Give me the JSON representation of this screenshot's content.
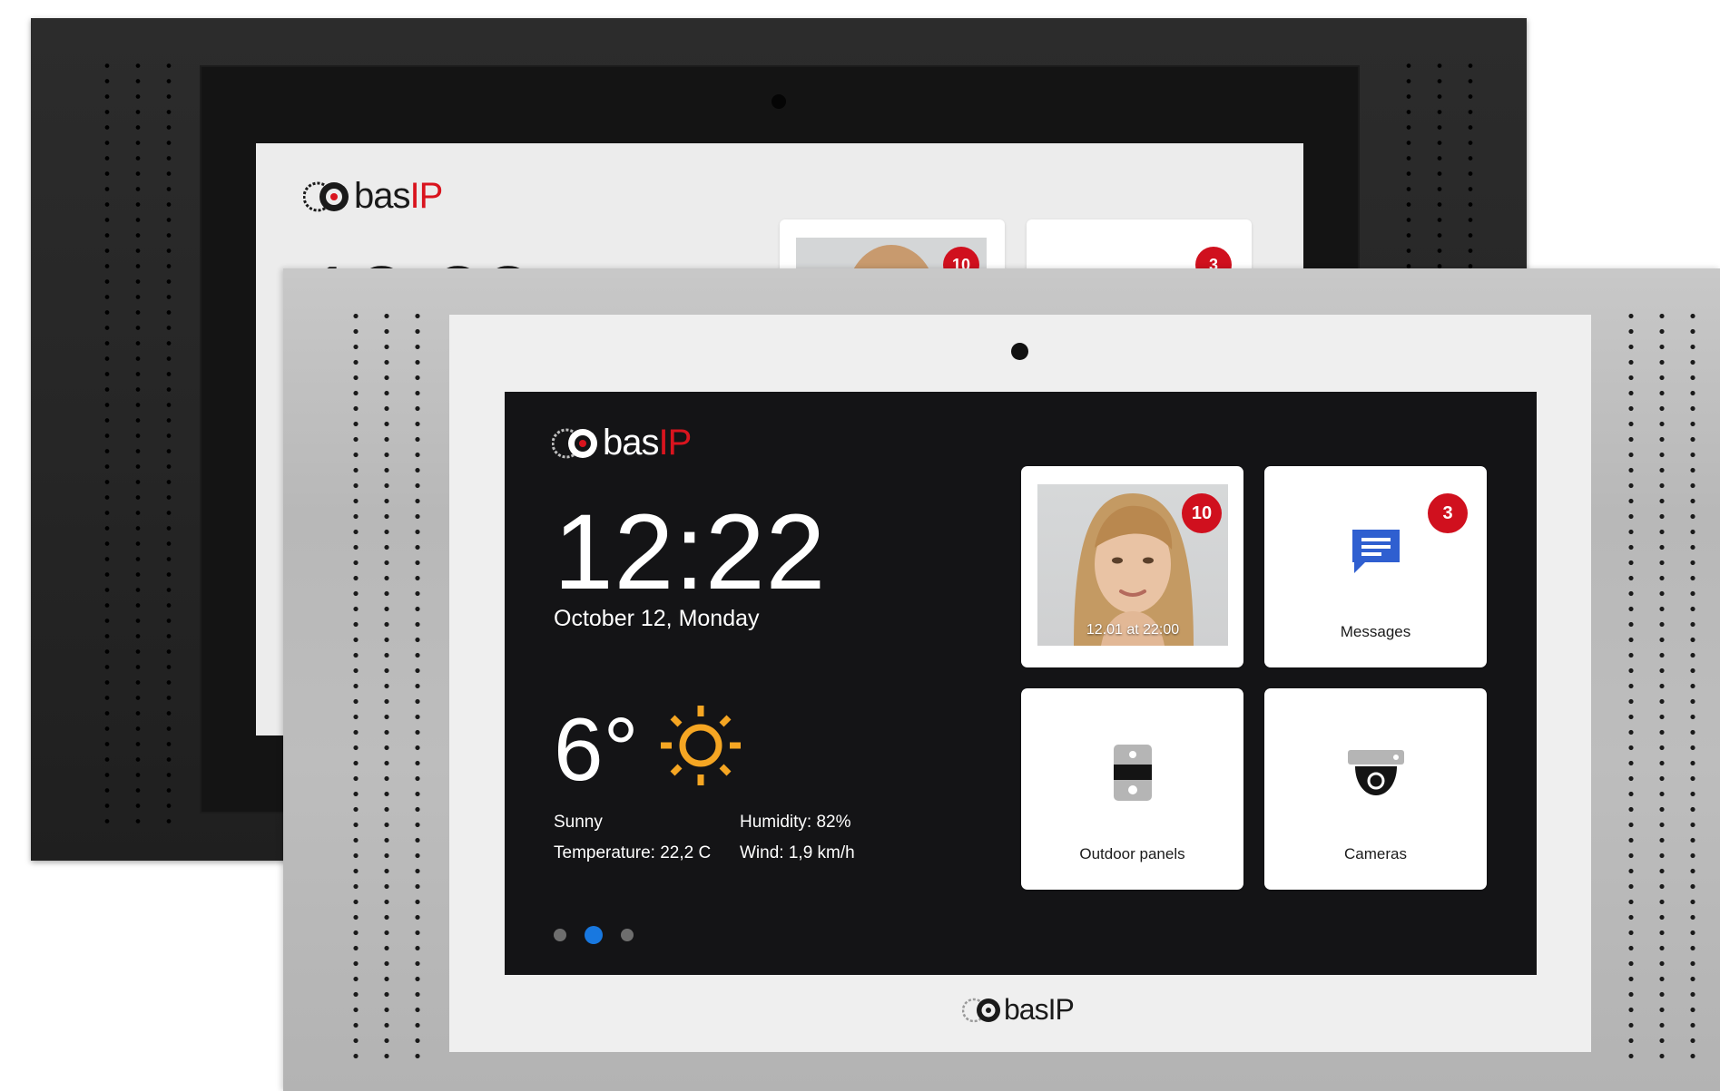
{
  "brand": {
    "name_part1": "bas",
    "name_part2": "IP",
    "accent_red": "#d9141e",
    "active_blue": "#1878e0"
  },
  "back_device": {
    "frame_color": "#262626",
    "screen_color": "#ececec",
    "badges": [
      "10",
      "3"
    ]
  },
  "front_device": {
    "frame_color": "#bdbdbd",
    "home": {
      "time": "12:22",
      "date": "October 12, Monday",
      "weather": {
        "temperature": "6°",
        "icon": "sun-icon",
        "condition": "Sunny",
        "temperature_detail": "Temperature: 22,2 C",
        "humidity": "Humidity: 82%",
        "wind": "Wind: 1,9 km/h"
      },
      "pager": {
        "pages": 3,
        "active_index": 1
      },
      "tiles": [
        {
          "id": "calls",
          "caption": "12.01 at 22:00",
          "badge": "10",
          "icon": "visitor-photo"
        },
        {
          "id": "messages",
          "label": "Messages",
          "badge": "3",
          "icon": "message-icon"
        },
        {
          "id": "outdoor-panels",
          "label": "Outdoor panels",
          "icon": "outdoor-panel-icon"
        },
        {
          "id": "cameras",
          "label": "Cameras",
          "icon": "camera-icon"
        }
      ]
    }
  }
}
